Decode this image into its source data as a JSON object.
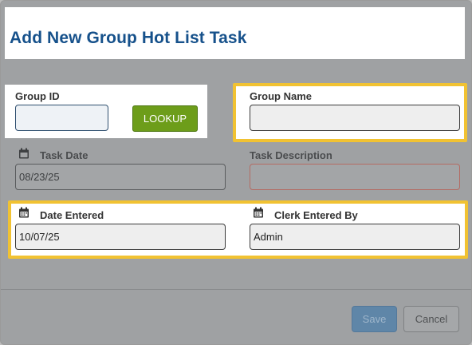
{
  "dialog": {
    "title": "Add New Group Hot List Task"
  },
  "form": {
    "group_id": {
      "label": "Group ID",
      "value": ""
    },
    "lookup_label": "LOOKUP",
    "group_name": {
      "label": "Group Name",
      "value": ""
    },
    "task_date": {
      "label": "Task Date",
      "value": "08/23/25"
    },
    "task_description": {
      "label": "Task Description",
      "value": ""
    },
    "date_entered": {
      "label": "Date Entered",
      "value": "10/07/25"
    },
    "clerk_entered_by": {
      "label": "Clerk Entered By",
      "value": "Admin"
    }
  },
  "footer": {
    "save_label": "Save",
    "cancel_label": "Cancel"
  },
  "colors": {
    "title": "#16518b",
    "lookup_button": "#6d9d1a",
    "highlight": "#f1c232",
    "save_button": "#5f86a8"
  },
  "icons": {
    "calendar": "calendar-icon"
  }
}
